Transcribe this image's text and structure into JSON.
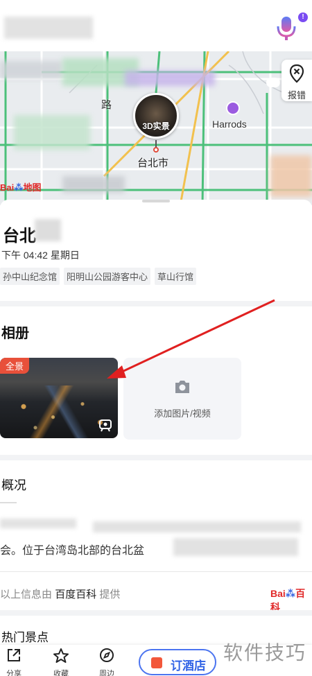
{
  "map": {
    "report_label": "报错",
    "pin_label": "3D实景",
    "city_label": "台北市",
    "road_label": "路",
    "poi_label": "Harrods",
    "logo_text": "Bai",
    "logo_text_2": "地图"
  },
  "place": {
    "title": "台北",
    "time": "下午 04:42 星期日",
    "tags": [
      "孙中山纪念馆",
      "阳明山公园游客中心",
      "草山行馆"
    ]
  },
  "album": {
    "title": "相册",
    "pano_badge": "全景",
    "add_label": "添加图片/视频"
  },
  "overview": {
    "title": "概况",
    "text": "会。位于台湾岛北部的台北盆",
    "source_prefix": "以上信息由",
    "source_name": "百度百科",
    "source_suffix": "提供",
    "source_logo": "Bai",
    "source_logo_2": "百科"
  },
  "hot": {
    "title": "热门景点"
  },
  "bottom_bar": {
    "share_label": "分享",
    "fav_label": "收藏",
    "nearby_label": "周边",
    "hotel_label": "订酒店"
  },
  "watermark": "软件技巧",
  "colors": {
    "accent": "#3163e6",
    "badge": "#e8503a",
    "arrow": "#e02020"
  }
}
